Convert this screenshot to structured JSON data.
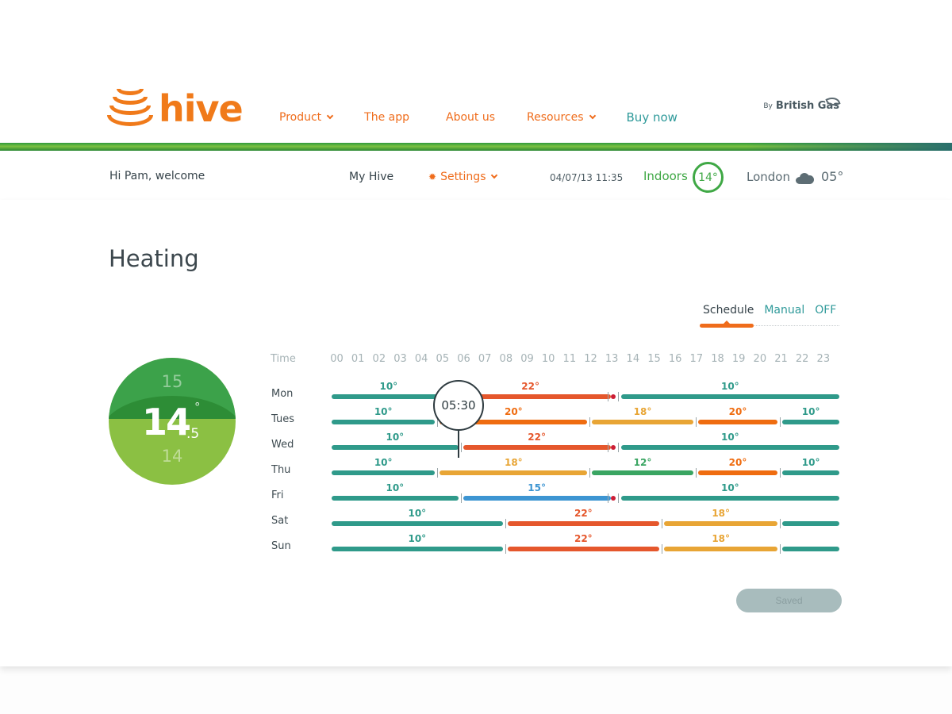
{
  "header": {
    "brand": "hive",
    "nav": [
      {
        "label": "Product",
        "dropdown": true
      },
      {
        "label": "The app",
        "dropdown": false
      },
      {
        "label": "About us",
        "dropdown": false
      },
      {
        "label": "Resources",
        "dropdown": true
      },
      {
        "label": "Buy now",
        "dropdown": false
      }
    ],
    "partner_prefix": "By",
    "partner_name": "British Gas"
  },
  "subheader": {
    "welcome": "Hi Pam, welcome",
    "my_hive": "My Hive",
    "settings": "Settings",
    "datetime": "04/07/13  11:35",
    "indoors_label": "Indoors",
    "indoors_temp": "14°",
    "city": "London",
    "weather_icon": "cloud-icon",
    "outdoor_temp": "05°"
  },
  "page": {
    "title": "Heating",
    "modes": [
      "Schedule",
      "Manual",
      "OFF"
    ],
    "active_mode": "Schedule"
  },
  "dial": {
    "above": "15",
    "current_whole": "14",
    "current_decimal": ".5",
    "degree": "°",
    "below": "14"
  },
  "schedule": {
    "time_label": "Time",
    "hours": [
      "00",
      "01",
      "02",
      "03",
      "04",
      "05",
      "06",
      "07",
      "08",
      "09",
      "10",
      "11",
      "12",
      "13",
      "14",
      "15",
      "16",
      "17",
      "18",
      "19",
      "20",
      "21",
      "22",
      "23"
    ],
    "colors": {
      "10": "#2f9a8a",
      "12": "#3aa562",
      "15": "#3d95d2",
      "18": "#e8a535",
      "20": "#ef6c10",
      "22": "#e5572c"
    },
    "days": [
      {
        "day": "Mon",
        "segments": [
          {
            "start": 0,
            "end": 5.5,
            "temp": "10°",
            "key": "10"
          },
          {
            "start": 5.5,
            "end": 13.3,
            "temp": "22°",
            "key": "22"
          },
          {
            "start": 13.3,
            "end": 24,
            "temp": "10°",
            "key": "10"
          }
        ],
        "marker_at": 13.3
      },
      {
        "day": "Tues",
        "segments": [
          {
            "start": 0,
            "end": 5,
            "temp": "10°",
            "key": "10"
          },
          {
            "start": 5,
            "end": 12.2,
            "temp": "20°",
            "key": "20"
          },
          {
            "start": 12.2,
            "end": 17.2,
            "temp": "18°",
            "key": "18"
          },
          {
            "start": 17.2,
            "end": 21.2,
            "temp": "20°",
            "key": "20"
          },
          {
            "start": 21.2,
            "end": 24,
            "temp": "10°",
            "key": "10"
          }
        ]
      },
      {
        "day": "Wed",
        "segments": [
          {
            "start": 0,
            "end": 6.1,
            "temp": "10°",
            "key": "10"
          },
          {
            "start": 6.1,
            "end": 13.3,
            "temp": "22°",
            "key": "22"
          },
          {
            "start": 13.3,
            "end": 24,
            "temp": "10°",
            "key": "10"
          }
        ],
        "marker_at": 13.3
      },
      {
        "day": "Thu",
        "segments": [
          {
            "start": 0,
            "end": 5,
            "temp": "10°",
            "key": "10"
          },
          {
            "start": 5,
            "end": 12.2,
            "temp": "18°",
            "key": "18"
          },
          {
            "start": 12.2,
            "end": 17.2,
            "temp": "12°",
            "key": "12"
          },
          {
            "start": 17.2,
            "end": 21.2,
            "temp": "20°",
            "key": "20"
          },
          {
            "start": 21.2,
            "end": 24,
            "temp": "10°",
            "key": "10"
          }
        ]
      },
      {
        "day": "Fri",
        "segments": [
          {
            "start": 0,
            "end": 6.1,
            "temp": "10°",
            "key": "10"
          },
          {
            "start": 6.1,
            "end": 13.3,
            "temp": "15°",
            "key": "15"
          },
          {
            "start": 13.3,
            "end": 24,
            "temp": "10°",
            "key": "10"
          }
        ],
        "marker_at": 13.3
      },
      {
        "day": "Sat",
        "segments": [
          {
            "start": 0,
            "end": 8.2,
            "temp": "10°",
            "key": "10"
          },
          {
            "start": 8.2,
            "end": 15.6,
            "temp": "22°",
            "key": "22"
          },
          {
            "start": 15.6,
            "end": 21.2,
            "temp": "18°",
            "key": "18"
          },
          {
            "start": 21.2,
            "end": 24,
            "temp": "",
            "key": "10"
          }
        ]
      },
      {
        "day": "Sun",
        "segments": [
          {
            "start": 0,
            "end": 8.2,
            "temp": "10°",
            "key": "10"
          },
          {
            "start": 8.2,
            "end": 15.6,
            "temp": "22°",
            "key": "22"
          },
          {
            "start": 15.6,
            "end": 21.2,
            "temp": "18°",
            "key": "18"
          },
          {
            "start": 21.2,
            "end": 24,
            "temp": "",
            "key": "10"
          }
        ]
      }
    ],
    "tooltip_time": "05:30"
  },
  "actions": {
    "saved_label": "Saved"
  }
}
